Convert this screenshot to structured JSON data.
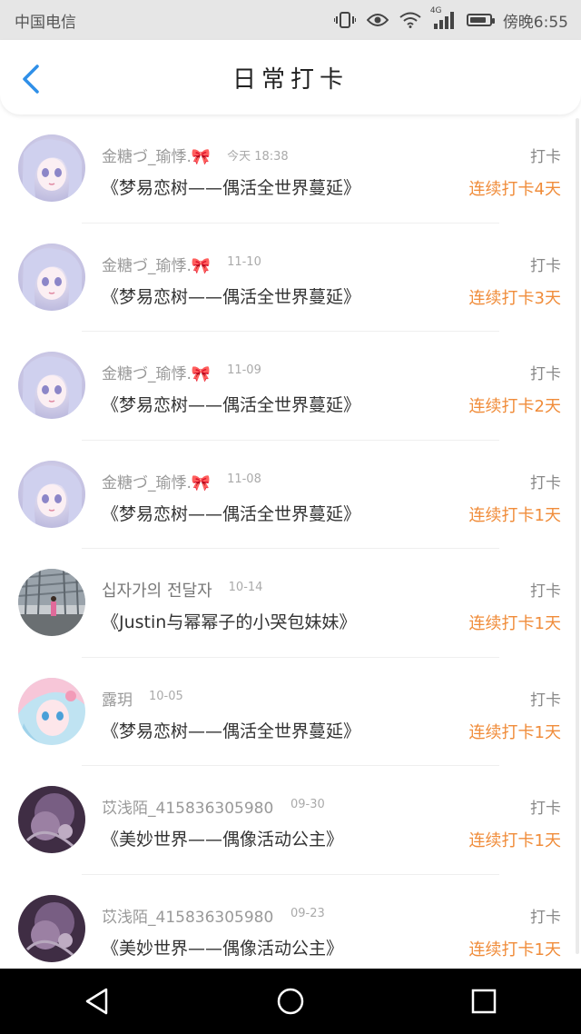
{
  "status_bar": {
    "carrier": "中国电信",
    "network": "4G",
    "time": "傍晚6:55",
    "battery_level": 0.85
  },
  "header": {
    "title": "日常打卡"
  },
  "checkins": [
    {
      "name": "金糖づ_瑜悸.🎀",
      "date": "今天 18:38",
      "action": "打卡",
      "book": "《梦易恋树——偶活全世界蔓延》",
      "streak": "连续打卡4天",
      "avatar": "anime-girl-lavender"
    },
    {
      "name": "金糖づ_瑜悸.🎀",
      "date": "11-10",
      "action": "打卡",
      "book": "《梦易恋树——偶活全世界蔓延》",
      "streak": "连续打卡3天",
      "avatar": "anime-girl-lavender"
    },
    {
      "name": "金糖づ_瑜悸.🎀",
      "date": "11-09",
      "action": "打卡",
      "book": "《梦易恋树——偶活全世界蔓延》",
      "streak": "连续打卡2天",
      "avatar": "anime-girl-lavender"
    },
    {
      "name": "金糖づ_瑜悸.🎀",
      "date": "11-08",
      "action": "打卡",
      "book": "《梦易恋树——偶活全世界蔓延》",
      "streak": "连续打卡1天",
      "avatar": "anime-girl-lavender"
    },
    {
      "name": "십자가의 전달자",
      "date": "10-14",
      "action": "打卡",
      "book": "《Justin与幂幂子的小哭包妹妹》",
      "streak": "连续打卡1天",
      "avatar": "building-photo"
    },
    {
      "name": "露玥",
      "date": "10-05",
      "action": "打卡",
      "book": "《梦易恋树——偶活全世界蔓延》",
      "streak": "连续打卡1天",
      "avatar": "anime-girl-pink"
    },
    {
      "name": "苡浅陌_415836305980…",
      "date": "09-30",
      "action": "打卡",
      "book": "《美妙世界——偶像活动公主》",
      "streak": "连续打卡1天",
      "avatar": "purple-flower"
    },
    {
      "name": "苡浅陌_415836305980…",
      "date": "09-23",
      "action": "打卡",
      "book": "《美妙世界——偶像活动公主》",
      "streak": "连续打卡1天",
      "avatar": "purple-flower"
    }
  ],
  "colors": {
    "accent_back": "#2f8fe8",
    "streak": "#f08c3a",
    "status_bar_bg": "#e6e6e6",
    "nav_bar_bg": "#000000"
  }
}
